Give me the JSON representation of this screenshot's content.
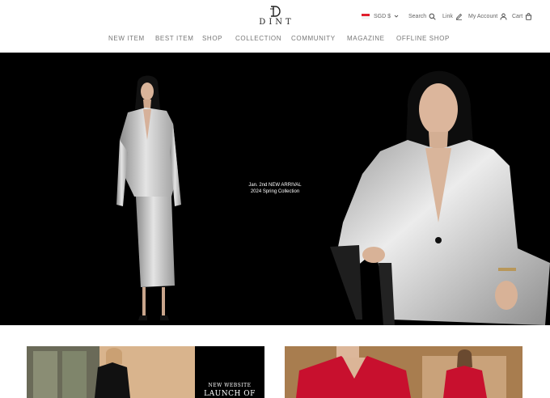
{
  "brand": {
    "name": "DINT"
  },
  "utility": {
    "currency": "SGD $",
    "search": "Search",
    "link": "Link",
    "account": "My Account",
    "cart": "Cart"
  },
  "nav": {
    "items": [
      "NEW ITEM",
      "BEST ITEM",
      "SHOP",
      "COLLECTION",
      "COMMUNITY",
      "MAGAZINE",
      "OFFLINE SHOP"
    ]
  },
  "hero": {
    "caption_line1": "Jan. 2nd NEW ARRIVAL",
    "caption_line2": "2024 Spring Collection"
  },
  "promo": {
    "left_line1": "NEW WEBSITE",
    "left_line2": "LAUNCH OF"
  },
  "colors": {
    "hero_bg": "#000000",
    "silver": "#c9c9c9",
    "accent_red": "#c8102e",
    "flag_red": "#e01e2b"
  },
  "icons": [
    "flag-icon",
    "chevron-down-icon",
    "search-icon",
    "pencil-icon",
    "user-icon",
    "cart-icon"
  ]
}
